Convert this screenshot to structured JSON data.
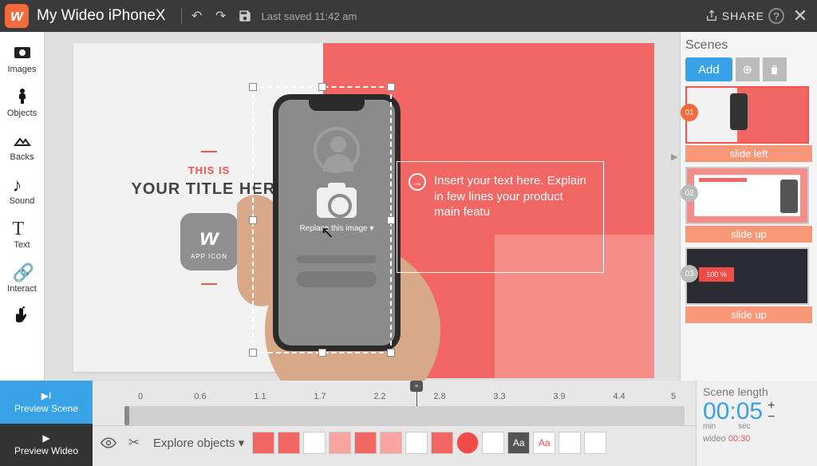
{
  "header": {
    "project_title": "My Wideo iPhoneX",
    "last_saved": "Last saved 11:42 am",
    "share": "SHARE"
  },
  "sidebar": {
    "items": [
      {
        "label": "Images"
      },
      {
        "label": "Objects"
      },
      {
        "label": "Backs"
      },
      {
        "label": "Sound"
      },
      {
        "label": "Text"
      },
      {
        "label": "Interact"
      },
      {
        "label": ""
      }
    ]
  },
  "canvas": {
    "supertitle": "THIS IS",
    "title": "YOUR TITLE HERE",
    "app_icon_label": "APP ICON",
    "replace_label": "Replace this image ▾",
    "card_text": "Insert your text here. Explain in few lines your product main featu"
  },
  "scenes": {
    "heading": "Scenes",
    "add": "Add",
    "items": [
      {
        "num": "01",
        "transition": "slide left"
      },
      {
        "num": "02",
        "transition": "slide up"
      },
      {
        "num": "03",
        "transition": "slide up",
        "badge": "100 %"
      }
    ]
  },
  "bottom": {
    "preview_scene": "Preview Scene",
    "preview_wideo": "Preview Wideo",
    "explore": "Explore objects ▾",
    "ticks": [
      "0",
      "0.6",
      "1.1",
      "1.7",
      "2.2",
      "2.8",
      "3.3",
      "3.9",
      "4.4",
      "5"
    ]
  },
  "scene_length": {
    "label": "Scene length",
    "time": "00:05",
    "min": "min",
    "sec": "sec",
    "wideo_label": "wideo",
    "wideo_time": "00:30"
  }
}
